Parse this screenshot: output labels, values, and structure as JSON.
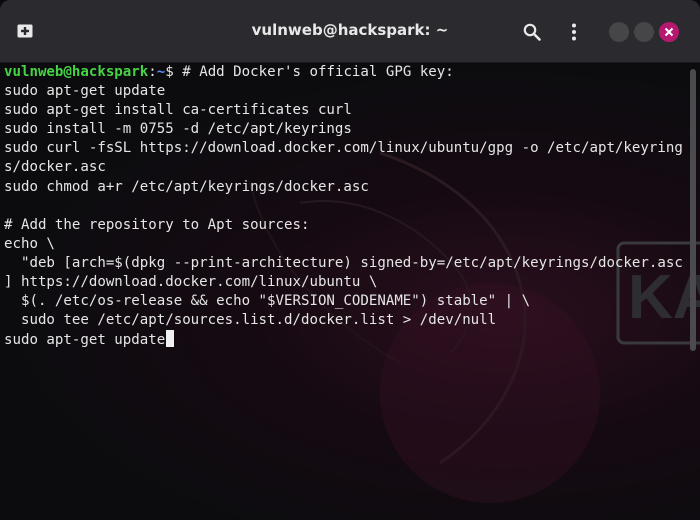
{
  "window": {
    "title": "vulnweb@hackspark: ~",
    "accent_close": "#b5186e"
  },
  "icons": {
    "new_tab": "new-tab-icon",
    "search": "search-icon",
    "menu": "kebab-menu-icon",
    "close": "close-icon"
  },
  "terminal": {
    "prompt_user": "vulnweb@hackspark",
    "prompt_sep": ":",
    "prompt_path": "~",
    "prompt_symbol": "$ ",
    "first_command": "# Add Docker's official GPG key:",
    "lines": [
      "sudo apt-get update",
      "sudo apt-get install ca-certificates curl",
      "sudo install -m 0755 -d /etc/apt/keyrings",
      "sudo curl -fsSL https://download.docker.com/linux/ubuntu/gpg -o /etc/apt/keyring",
      "s/docker.asc",
      "sudo chmod a+r /etc/apt/keyrings/docker.asc",
      "",
      "# Add the repository to Apt sources:",
      "echo \\",
      "  \"deb [arch=$(dpkg --print-architecture) signed-by=/etc/apt/keyrings/docker.asc",
      "] https://download.docker.com/linux/ubuntu \\",
      "  $(. /etc/os-release && echo \"$VERSION_CODENAME\") stable\" | \\",
      "  sudo tee /etc/apt/sources.list.d/docker.list > /dev/null"
    ],
    "current_input": "sudo apt-get update",
    "wallpaper_text": "KA",
    "colors": {
      "user": "#46d346",
      "path": "#5b8cff",
      "text": "#e6e6e6"
    }
  }
}
